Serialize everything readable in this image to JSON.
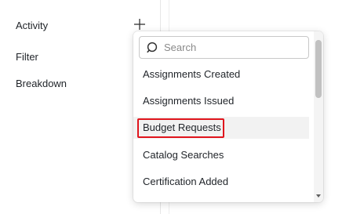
{
  "filters_panel": {
    "activity_label": "Activity",
    "filter_label": "Filter",
    "breakdown_label": "Breakdown"
  },
  "activity_dropdown": {
    "search_placeholder": "Search",
    "options": [
      {
        "label": "Assignments Created"
      },
      {
        "label": "Assignments Issued"
      },
      {
        "label": "Budget Requests",
        "state": "hovered, outlined in red"
      },
      {
        "label": "Catalog Searches"
      },
      {
        "label": "Certification Added"
      }
    ]
  },
  "colors": {
    "highlight_outline": "#e0151d",
    "hover_background": "#f2f2f2"
  },
  "icons": {
    "add": "plus-icon",
    "search": "search-icon"
  }
}
